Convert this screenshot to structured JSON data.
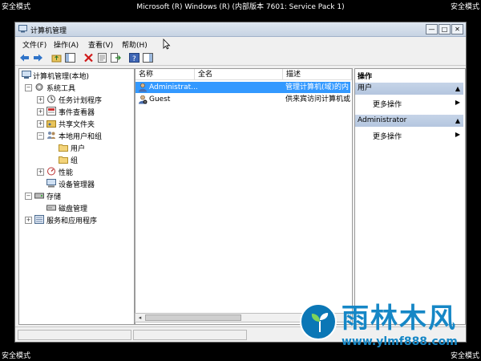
{
  "desktop": {
    "safe_mode": "安全模式",
    "os_title": "Microsoft (R) Windows (R) (内部版本 7601: Service Pack 1)"
  },
  "window": {
    "title": "计算机管理",
    "buttons": {
      "minimize": "—",
      "restore": "□",
      "close": "✕"
    }
  },
  "menu": [
    {
      "label": "文件(F)"
    },
    {
      "label": "操作(A)"
    },
    {
      "label": "查看(V)"
    },
    {
      "label": "帮助(H)"
    }
  ],
  "tree": [
    {
      "label": "计算机管理(本地)",
      "expander": ""
    },
    {
      "label": "系统工具",
      "expander": "−"
    },
    {
      "label": "任务计划程序",
      "expander": "+"
    },
    {
      "label": "事件查看器",
      "expander": "+"
    },
    {
      "label": "共享文件夹",
      "expander": "+"
    },
    {
      "label": "本地用户和组",
      "expander": "−"
    },
    {
      "label": "用户",
      "expander": ""
    },
    {
      "label": "组",
      "expander": ""
    },
    {
      "label": "性能",
      "expander": "+"
    },
    {
      "label": "设备管理器",
      "expander": ""
    },
    {
      "label": "存储",
      "expander": "−"
    },
    {
      "label": "磁盘管理",
      "expander": ""
    },
    {
      "label": "服务和应用程序",
      "expander": "+"
    }
  ],
  "list": {
    "columns": [
      "名称",
      "全名",
      "描述"
    ],
    "rows": [
      {
        "name": "Administrat...",
        "full_name": "",
        "description": "管理计算机(域)的内",
        "selected": true
      },
      {
        "name": "Guest",
        "full_name": "",
        "description": "供来宾访问计算机或",
        "selected": false
      }
    ]
  },
  "actions": {
    "title": "操作",
    "sections": [
      {
        "label": "用户",
        "link": "更多操作"
      },
      {
        "label": "Administrator",
        "link": "更多操作"
      }
    ]
  },
  "watermark": {
    "text": "雨林木风",
    "url": "www.ylmf888.com"
  }
}
